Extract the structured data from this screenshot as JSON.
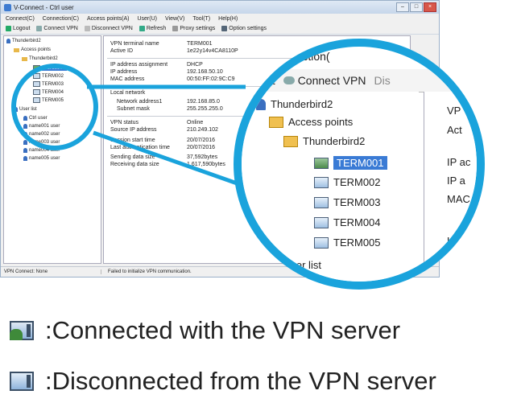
{
  "window": {
    "title": "V-Connect - Ctrl user",
    "menu": [
      "Connect(C)",
      "Connection(C)",
      "Access points(A)",
      "User(U)",
      "View(V)",
      "Tool(T)",
      "Help(H)"
    ],
    "toolbar": [
      "Logout",
      "Connect VPN",
      "Disconnect VPN",
      "Refresh",
      "Proxy settings",
      "Option settings"
    ]
  },
  "tree": {
    "root": "Thunderbird2",
    "access_points_label": "Access points",
    "group": "Thunderbird2",
    "terminals": [
      {
        "name": "TERM001",
        "state": "connected",
        "selected": true
      },
      {
        "name": "TERM002",
        "state": "disconnected"
      },
      {
        "name": "TERM003",
        "state": "disconnected"
      },
      {
        "name": "TERM004",
        "state": "disconnected"
      },
      {
        "name": "TERM005",
        "state": "disconnected"
      }
    ],
    "user_list_label": "User list",
    "users": [
      "Ctrl user",
      "name001 user",
      "name002 user",
      "name003 user",
      "name004 user",
      "name005 user"
    ]
  },
  "details": {
    "vpn_terminal_name_label": "VPN terminal name",
    "vpn_terminal_name": "TERM001",
    "active_id_label": "Active ID",
    "active_id": "1e22y14v4CA8110P",
    "ip_assignment_label": "IP address assignment",
    "ip_assignment": "DHCP",
    "ip_address_label": "IP address",
    "ip_address": "192.168.50.10",
    "mac_address_label": "MAC address",
    "mac_address": "00:50:FF:02:9C:C9",
    "local_network_label": "Local network",
    "network_address_label": "Network address1",
    "network_address": "192.168.85.0",
    "subnet_mask_label": "Subnet mask",
    "subnet_mask": "255.255.255.0",
    "vpn_status_label": "VPN status",
    "vpn_status": "Online",
    "source_ip_label": "Source IP address",
    "source_ip": "210.249.102",
    "session_start_label": "Session start time",
    "session_start": "20/07/2016",
    "last_auth_label": "Last authentication time",
    "last_auth": "20/07/2016",
    "sending_size_label": "Sending data size",
    "sending_size": "37,592bytes",
    "receiving_size_label": "Receiving data size",
    "receiving_size": "1,617,590bytes"
  },
  "status": {
    "left": "VPN Connect: None",
    "right": "Failed to initialize VPN communication."
  },
  "zoom": {
    "menu_fragment": "nnection(",
    "toolbar_logout": "ut",
    "toolbar_connect": "Connect VPN",
    "toolbar_dis": "Dis",
    "right_labels": [
      "VP",
      "Act",
      "IP ac",
      "IP a",
      "MAC",
      "L"
    ]
  },
  "legend": {
    "connected": ":Connected with the VPN server",
    "disconnected": ":Disconnected from the VPN server"
  },
  "colors": {
    "lens": "#1aa3dc",
    "selection": "#3a7bd5"
  }
}
